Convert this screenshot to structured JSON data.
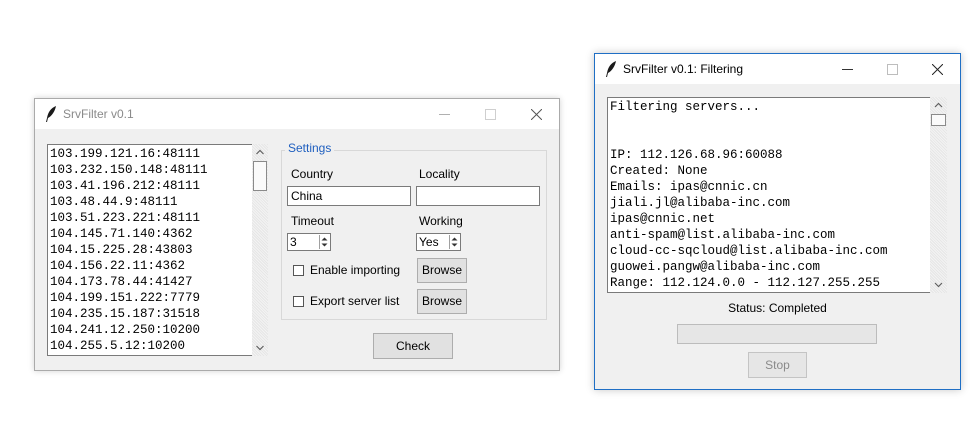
{
  "main_window": {
    "title": "SrvFilter v0.1",
    "servers": [
      "103.199.121.16:48111",
      "103.232.150.148:48111",
      "103.41.196.212:48111",
      "103.48.44.9:48111",
      "103.51.223.221:48111",
      "104.145.71.140:4362",
      "104.15.225.28:43803",
      "104.156.22.11:4362",
      "104.173.78.44:41427",
      "104.199.151.222:7779",
      "104.235.15.187:31518",
      "104.241.12.250:10200",
      "104.255.5.12:10200"
    ],
    "settings": {
      "group_label": "Settings",
      "country_label": "Country",
      "country_value": "China",
      "locality_label": "Locality",
      "locality_value": "",
      "timeout_label": "Timeout",
      "timeout_value": "3",
      "working_label": "Working",
      "working_value": "Yes",
      "enable_importing_label": "Enable importing",
      "enable_importing_checked": false,
      "export_label": "Export server list",
      "export_checked": false,
      "browse_label": "Browse"
    },
    "check_label": "Check"
  },
  "filter_window": {
    "title": "SrvFilter v0.1: Filtering",
    "output_lines": [
      "Filtering servers...",
      "",
      "",
      "IP: 112.126.68.96:60088",
      "Created: None",
      "Emails: ipas@cnnic.cn",
      "jiali.jl@alibaba-inc.com",
      "ipas@cnnic.net",
      "anti-spam@list.alibaba-inc.com",
      "cloud-cc-sqcloud@list.alibaba-inc.com",
      "guowei.pangw@alibaba-inc.com",
      "Range: 112.124.0.0 - 112.127.255.255"
    ],
    "status_text": "Status: Completed",
    "progress": 0,
    "stop_label": "Stop"
  }
}
